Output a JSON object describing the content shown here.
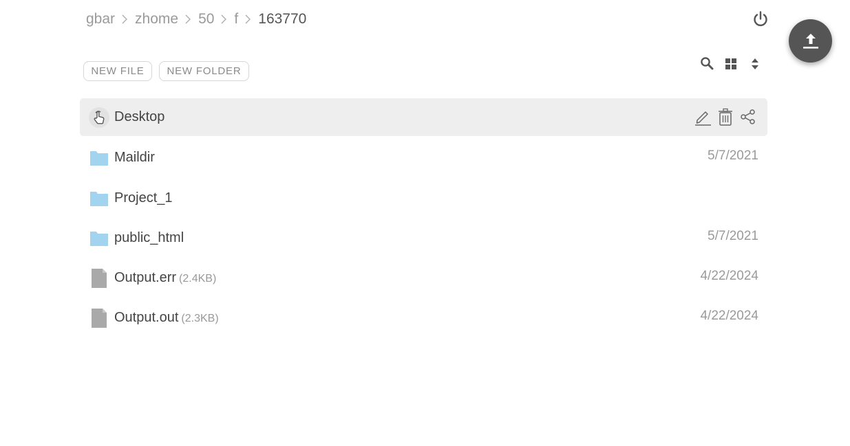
{
  "breadcrumb": {
    "items": [
      "gbar",
      "zhome",
      "50",
      "f"
    ],
    "current": "163770"
  },
  "toolbar": {
    "new_file_label": "NEW FILE",
    "new_folder_label": "NEW FOLDER"
  },
  "icons": {
    "power": "power-icon",
    "upload": "upload-icon",
    "search": "search-icon",
    "grid": "grid-view-icon",
    "sort": "sort-icon",
    "folder": "folder-icon",
    "file": "file-icon",
    "edit": "edit-icon",
    "delete": "trash-icon",
    "share": "share-icon"
  },
  "colors": {
    "folder": "#a3d4ef",
    "file": "#a9a9a9",
    "fab": "#555555",
    "selected_row": "#eeeeee"
  },
  "files": [
    {
      "name": "Desktop",
      "type": "folder",
      "date": "",
      "size": "",
      "selected": true
    },
    {
      "name": "Maildir",
      "type": "folder",
      "date": "5/7/2021",
      "size": ""
    },
    {
      "name": "Project_1",
      "type": "folder",
      "date": "",
      "size": ""
    },
    {
      "name": "public_html",
      "type": "folder",
      "date": "5/7/2021",
      "size": ""
    },
    {
      "name": "Output.err",
      "type": "file",
      "date": "4/22/2024",
      "size": "(2.4KB)"
    },
    {
      "name": "Output.out",
      "type": "file",
      "date": "4/22/2024",
      "size": "(2.3KB)"
    }
  ]
}
